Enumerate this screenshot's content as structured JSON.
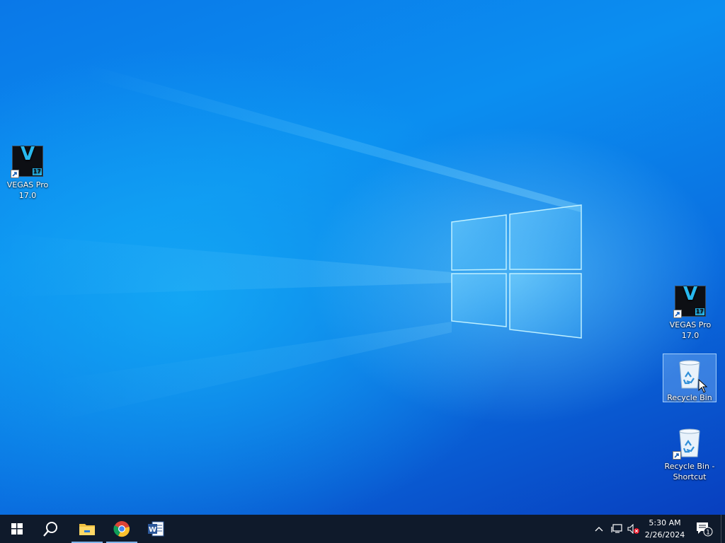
{
  "desktop": {
    "icons": [
      {
        "label": "VEGAS Pro 17.0",
        "type": "vegas",
        "version_badge": "17",
        "letter": "V"
      },
      {
        "label": "VEGAS Pro 17.0",
        "type": "vegas",
        "version_badge": "17",
        "letter": "V"
      },
      {
        "label": "Recycle Bin",
        "type": "recycle-bin",
        "selected": true
      },
      {
        "label": "Recycle Bin - Shortcut",
        "type": "recycle-bin-shortcut"
      }
    ]
  },
  "taskbar": {
    "buttons": [
      {
        "name": "start",
        "icon": "windows-logo-icon"
      },
      {
        "name": "search",
        "icon": "search-icon"
      },
      {
        "name": "file-explorer",
        "icon": "folder-icon",
        "active": true
      },
      {
        "name": "chrome",
        "icon": "chrome-icon",
        "active": true
      },
      {
        "name": "word",
        "icon": "word-icon"
      }
    ],
    "tray": {
      "clock_time": "5:30 AM",
      "clock_date": "2/26/2024",
      "notification_count": "1"
    }
  },
  "colors": {
    "taskbar": "#0f1a2b",
    "vegas_accent": "#28b9ef",
    "desktop_blue": "#0a78e8"
  }
}
